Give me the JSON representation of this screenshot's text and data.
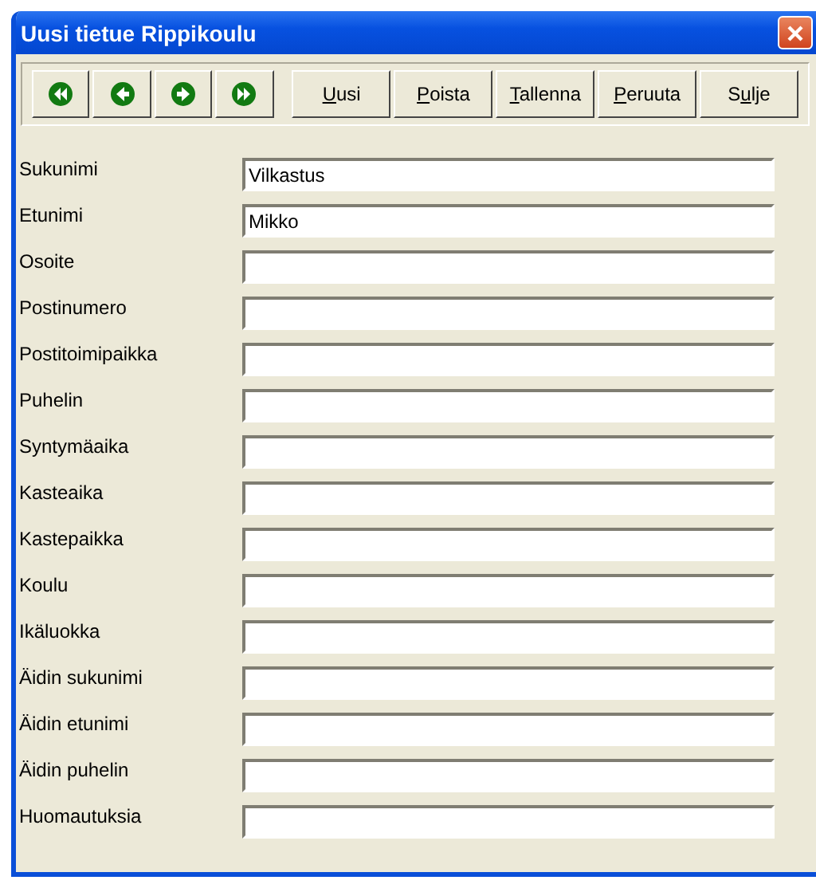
{
  "window": {
    "title": "Uusi tietue Rippikoulu"
  },
  "nav_buttons": [
    {
      "kind": "first"
    },
    {
      "kind": "prev"
    },
    {
      "kind": "next"
    },
    {
      "kind": "last"
    }
  ],
  "buttons": [
    {
      "mnemonic": "U",
      "after": "usi"
    },
    {
      "mnemonic": "P",
      "after": "oista"
    },
    {
      "mnemonic": "T",
      "after": "allenna"
    },
    {
      "mnemonic": "P",
      "after": "eruuta"
    },
    {
      "before": "S",
      "mnemonic": "u",
      "after": "lje"
    }
  ],
  "fields": [
    {
      "label": "Sukunimi",
      "value": "Vilkastus"
    },
    {
      "label": "Etunimi",
      "value": "Mikko"
    },
    {
      "label": "Osoite"
    },
    {
      "label": "Postinumero"
    },
    {
      "label": "Postitoimipaikka"
    },
    {
      "label": "Puhelin"
    },
    {
      "label": "Syntymäaika"
    },
    {
      "label": "Kasteaika"
    },
    {
      "label": "Kastepaikka"
    },
    {
      "label": "Koulu"
    },
    {
      "label": "Ikäluokka"
    },
    {
      "label": "Äidin sukunimi"
    },
    {
      "label": "Äidin etunimi"
    },
    {
      "label": "Äidin puhelin"
    },
    {
      "label": "Huomautuksia"
    }
  ]
}
